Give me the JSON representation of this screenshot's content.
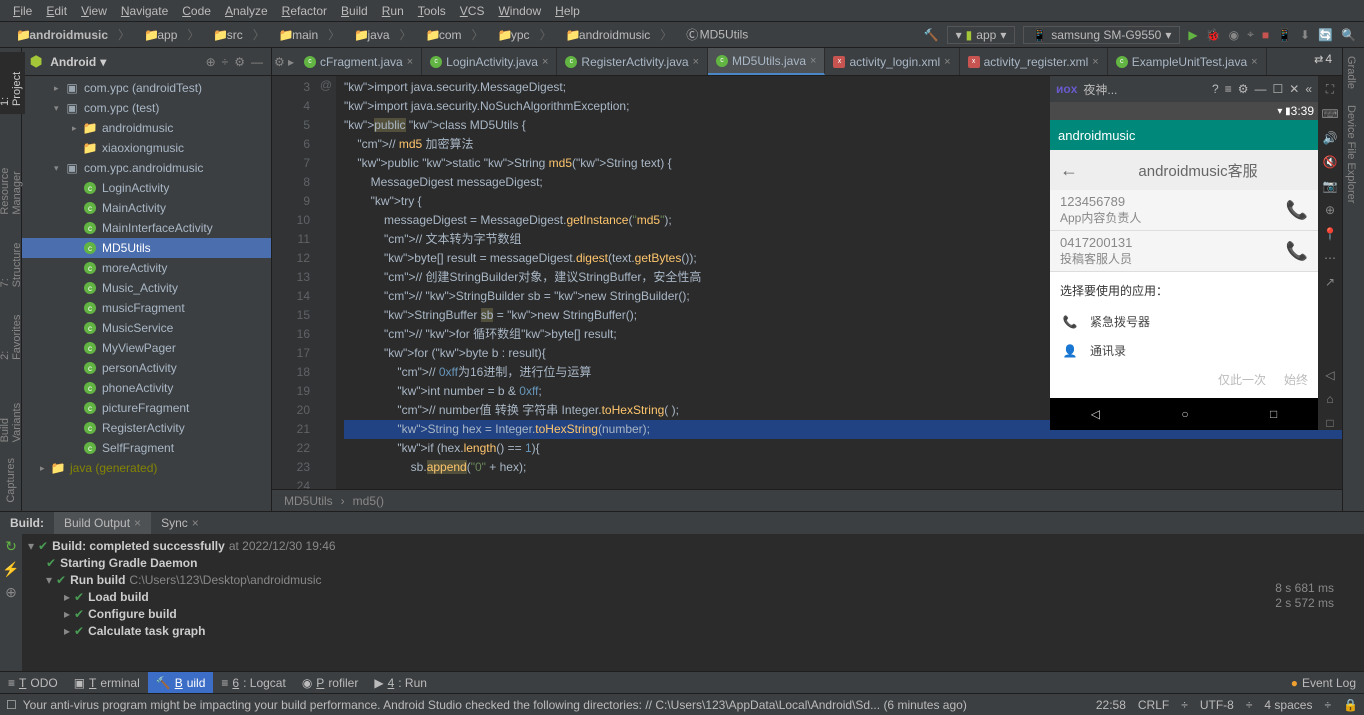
{
  "menu": [
    "File",
    "Edit",
    "View",
    "Navigate",
    "Code",
    "Analyze",
    "Refactor",
    "Build",
    "Run",
    "Tools",
    "VCS",
    "Window",
    "Help"
  ],
  "breadcrumb": [
    "androidmusic",
    "app",
    "src",
    "main",
    "java",
    "com",
    "ypc",
    "androidmusic",
    "MD5Utils"
  ],
  "run": {
    "config": "app",
    "device": "samsung SM-G9550"
  },
  "sidebar": {
    "title": "Android",
    "items": [
      {
        "t": "com.ypc (androidTest)",
        "l": 0,
        "i": "pkg",
        "ch": "▸"
      },
      {
        "t": "com.ypc (test)",
        "l": 0,
        "i": "pkg",
        "ch": "▾"
      },
      {
        "t": "androidmusic",
        "l": 1,
        "i": "fld",
        "ch": "▸"
      },
      {
        "t": "xiaoxiongmusic",
        "l": 1,
        "i": "fld",
        "ch": ""
      },
      {
        "t": "com.ypc.androidmusic",
        "l": 0,
        "i": "pkg",
        "ch": "▾"
      },
      {
        "t": "LoginActivity",
        "l": 1,
        "i": "c"
      },
      {
        "t": "MainActivity",
        "l": 1,
        "i": "c"
      },
      {
        "t": "MainInterfaceActivity",
        "l": 1,
        "i": "c"
      },
      {
        "t": "MD5Utils",
        "l": 1,
        "i": "c",
        "sel": true
      },
      {
        "t": "moreActivity",
        "l": 1,
        "i": "c"
      },
      {
        "t": "Music_Activity",
        "l": 1,
        "i": "c"
      },
      {
        "t": "musicFragment",
        "l": 1,
        "i": "c"
      },
      {
        "t": "MusicService",
        "l": 1,
        "i": "c"
      },
      {
        "t": "MyViewPager",
        "l": 1,
        "i": "c"
      },
      {
        "t": "personActivity",
        "l": 1,
        "i": "c"
      },
      {
        "t": "phoneActivity",
        "l": 1,
        "i": "c"
      },
      {
        "t": "pictureFragment",
        "l": 1,
        "i": "c"
      },
      {
        "t": "RegisterActivity",
        "l": 1,
        "i": "c"
      },
      {
        "t": "SelfFragment",
        "l": 1,
        "i": "c"
      },
      {
        "t": "java (generated)",
        "l": -1,
        "i": "jfld",
        "ch": "▸",
        "gen": true
      }
    ]
  },
  "tabs": [
    {
      "t": "cFragment.java",
      "ico": "c",
      "trunc": true
    },
    {
      "t": "LoginActivity.java",
      "ico": "c"
    },
    {
      "t": "RegisterActivity.java",
      "ico": "c"
    },
    {
      "t": "MD5Utils.java",
      "ico": "c",
      "active": true
    },
    {
      "t": "activity_login.xml",
      "ico": "xml"
    },
    {
      "t": "activity_register.xml",
      "ico": "xml"
    },
    {
      "t": "ExampleUnitTest.java",
      "ico": "c"
    }
  ],
  "hideCount": "4",
  "code": {
    "start": 3,
    "lines": [
      "import java.security.MessageDigest;",
      "import java.security.NoSuchAlgorithmException;",
      "",
      "public class MD5Utils {",
      "    // md5 加密算法",
      "    public static String md5(String text) {",
      "        MessageDigest messageDigest;",
      "        try {",
      "            messageDigest = MessageDigest.getInstance(\"md5\");",
      "            // 文本转为字节数组",
      "            byte[] result = messageDigest.digest(text.getBytes());",
      "            // 创建StringBuilder对象，建议StringBuffer，安全性高",
      "            // StringBuilder sb = new StringBuilder();",
      "            StringBuffer sb = new StringBuffer();",
      "            // for 循环数组byte[] result;",
      "            for (byte b : result){",
      "                // 0xff为16进制，进行位与运算",
      "                int number = b & 0xff;",
      "                // number值 转换 字符串 Integer.toHexString( );",
      "                String hex = Integer.toHexString(number);",
      "                if (hex.length() == 1){",
      "                    sb.append(\"0\" + hex);"
    ]
  },
  "crumbBar": [
    "MD5Utils",
    "md5()"
  ],
  "buildPanel": {
    "tabs": [
      "Build:",
      "Build Output",
      "Sync"
    ],
    "rows": [
      {
        "t": "Build: completed successfully",
        "time": "at 2022/12/30 19:46",
        "l": 0,
        "ch": "▾"
      },
      {
        "t": "Starting Gradle Daemon",
        "l": 1
      },
      {
        "t": "Run build",
        "path": "C:\\Users\\123\\Desktop\\androidmusic",
        "l": 1,
        "ch": "▾"
      },
      {
        "t": "Load build",
        "l": 2,
        "ch": "▸"
      },
      {
        "t": "Configure build",
        "l": 2,
        "ch": "▸"
      },
      {
        "t": "Calculate task graph",
        "l": 2,
        "ch": "▸"
      }
    ],
    "times": [
      "8 s 681 ms",
      "2 s 572 ms"
    ]
  },
  "bottomTabs": [
    {
      "t": "TODO",
      "ico": "≡"
    },
    {
      "t": "Terminal",
      "ico": "▣"
    },
    {
      "t": "Build",
      "ico": "🔨",
      "active": true
    },
    {
      "t": "6: Logcat",
      "ico": "≡"
    },
    {
      "t": "Profiler",
      "ico": "◉"
    },
    {
      "t": "4: Run",
      "ico": "▶"
    }
  ],
  "eventLog": "Event Log",
  "status": {
    "msg": "Your anti-virus program might be impacting your build performance. Android Studio checked the following directories: // C:\\Users\\123\\AppData\\Local\\Android\\Sd... (6 minutes ago)",
    "pos": "22:58",
    "crlf": "CRLF",
    "enc": "UTF-8",
    "indent": "4 spaces"
  },
  "emulator": {
    "title": "夜神...",
    "time": "3:39",
    "appname": "androidmusic",
    "header": "androidmusic客服",
    "contacts": [
      {
        "num": "123456789",
        "lbl": "App内容负责人"
      },
      {
        "num": "0417200131",
        "lbl": "投稿客服人员"
      }
    ],
    "sheet": {
      "title": "选择要使用的应用：",
      "opts": [
        {
          "i": "📞",
          "t": "紧急拨号器",
          "c": "#3b82f6"
        },
        {
          "i": "👤",
          "t": "通讯录",
          "c": "#3b82f6"
        }
      ],
      "footer": [
        "仅此一次",
        "始终"
      ]
    }
  },
  "leftTabs": [
    "1: Project",
    "Resource Manager",
    "7: Structure",
    "2: Favorites",
    "Build Variants",
    "Captures"
  ],
  "rightTabs": [
    "Gradle",
    "Device File Explorer"
  ]
}
